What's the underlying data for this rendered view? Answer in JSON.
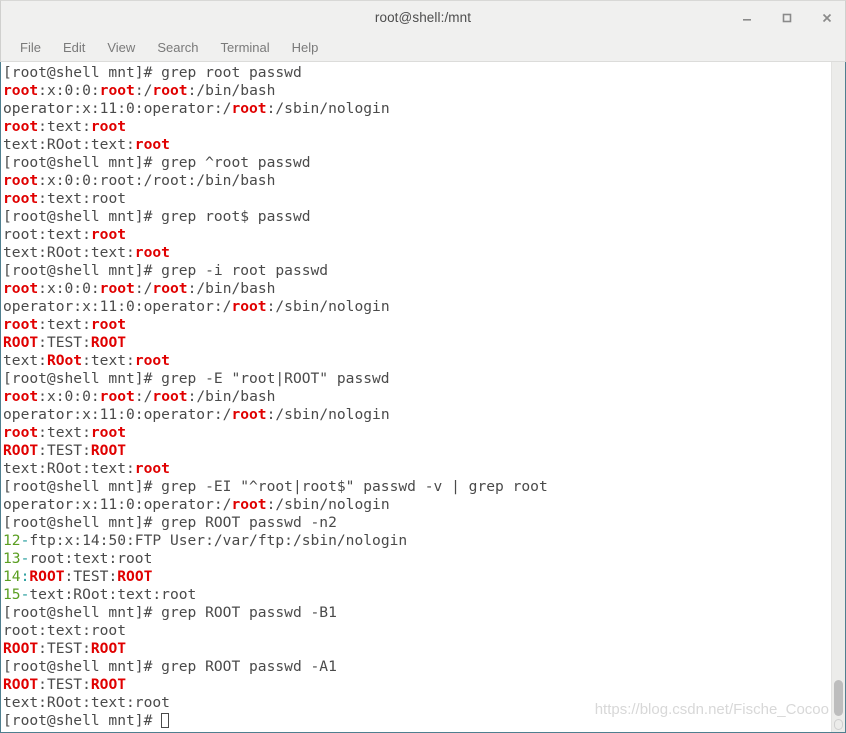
{
  "window": {
    "title": "root@shell:/mnt",
    "buttons": [
      {
        "name": "minimize",
        "glyph": "minimize-icon"
      },
      {
        "name": "maximize",
        "glyph": "maximize-icon"
      },
      {
        "name": "close",
        "glyph": "close-icon"
      }
    ]
  },
  "menubar": {
    "items": [
      "File",
      "Edit",
      "View",
      "Search",
      "Terminal",
      "Help"
    ]
  },
  "colors": {
    "match": "#e00000",
    "line_number": "#5a9e21",
    "separator": "#1f9a9a",
    "text": "#4a4a4a",
    "background": "#ffffff",
    "chrome": "#f0f0ef",
    "border": "#4f7f8f"
  },
  "watermark": "https://blog.csdn.net/Fische_Cocoo",
  "terminal": {
    "prompt": "[root@shell mnt]# ",
    "lines": [
      {
        "type": "prompt",
        "command": "grep root passwd"
      },
      {
        "type": "out",
        "parts": [
          {
            "t": "root",
            "c": "m"
          },
          {
            "t": ":x:0:0:"
          },
          {
            "t": "root",
            "c": "m"
          },
          {
            "t": ":/"
          },
          {
            "t": "root",
            "c": "m"
          },
          {
            "t": ":/bin/bash"
          }
        ]
      },
      {
        "type": "out",
        "parts": [
          {
            "t": "operator:x:11:0:operator:/"
          },
          {
            "t": "root",
            "c": "m"
          },
          {
            "t": ":/sbin/nologin"
          }
        ]
      },
      {
        "type": "out",
        "parts": [
          {
            "t": "root",
            "c": "m"
          },
          {
            "t": ":text:"
          },
          {
            "t": "root",
            "c": "m"
          }
        ]
      },
      {
        "type": "out",
        "parts": [
          {
            "t": "text:ROot:text:"
          },
          {
            "t": "root",
            "c": "m"
          }
        ]
      },
      {
        "type": "prompt",
        "command": "grep ^root passwd"
      },
      {
        "type": "out",
        "parts": [
          {
            "t": "root",
            "c": "m"
          },
          {
            "t": ":x:0:0:root:/root:/bin/bash"
          }
        ]
      },
      {
        "type": "out",
        "parts": [
          {
            "t": "root",
            "c": "m"
          },
          {
            "t": ":text:root"
          }
        ]
      },
      {
        "type": "prompt",
        "command": "grep root$ passwd"
      },
      {
        "type": "out",
        "parts": [
          {
            "t": "root:text:"
          },
          {
            "t": "root",
            "c": "m"
          }
        ]
      },
      {
        "type": "out",
        "parts": [
          {
            "t": "text:ROot:text:"
          },
          {
            "t": "root",
            "c": "m"
          }
        ]
      },
      {
        "type": "prompt",
        "command": "grep -i root passwd"
      },
      {
        "type": "out",
        "parts": [
          {
            "t": "root",
            "c": "m"
          },
          {
            "t": ":x:0:0:"
          },
          {
            "t": "root",
            "c": "m"
          },
          {
            "t": ":/"
          },
          {
            "t": "root",
            "c": "m"
          },
          {
            "t": ":/bin/bash"
          }
        ]
      },
      {
        "type": "out",
        "parts": [
          {
            "t": "operator:x:11:0:operator:/"
          },
          {
            "t": "root",
            "c": "m"
          },
          {
            "t": ":/sbin/nologin"
          }
        ]
      },
      {
        "type": "out",
        "parts": [
          {
            "t": "root",
            "c": "m"
          },
          {
            "t": ":text:"
          },
          {
            "t": "root",
            "c": "m"
          }
        ]
      },
      {
        "type": "out",
        "parts": [
          {
            "t": "ROOT",
            "c": "m"
          },
          {
            "t": ":TEST:"
          },
          {
            "t": "ROOT",
            "c": "m"
          }
        ]
      },
      {
        "type": "out",
        "parts": [
          {
            "t": "text:"
          },
          {
            "t": "ROot",
            "c": "m"
          },
          {
            "t": ":text:"
          },
          {
            "t": "root",
            "c": "m"
          }
        ]
      },
      {
        "type": "prompt",
        "command": "grep -E \"root|ROOT\" passwd"
      },
      {
        "type": "out",
        "parts": [
          {
            "t": "root",
            "c": "m"
          },
          {
            "t": ":x:0:0:"
          },
          {
            "t": "root",
            "c": "m"
          },
          {
            "t": ":/"
          },
          {
            "t": "root",
            "c": "m"
          },
          {
            "t": ":/bin/bash"
          }
        ]
      },
      {
        "type": "out",
        "parts": [
          {
            "t": "operator:x:11:0:operator:/"
          },
          {
            "t": "root",
            "c": "m"
          },
          {
            "t": ":/sbin/nologin"
          }
        ]
      },
      {
        "type": "out",
        "parts": [
          {
            "t": "root",
            "c": "m"
          },
          {
            "t": ":text:"
          },
          {
            "t": "root",
            "c": "m"
          }
        ]
      },
      {
        "type": "out",
        "parts": [
          {
            "t": "ROOT",
            "c": "m"
          },
          {
            "t": ":TEST:"
          },
          {
            "t": "ROOT",
            "c": "m"
          }
        ]
      },
      {
        "type": "out",
        "parts": [
          {
            "t": "text:ROot:text:"
          },
          {
            "t": "root",
            "c": "m"
          }
        ]
      },
      {
        "type": "prompt",
        "command": "grep -EI \"^root|root$\" passwd -v | grep root"
      },
      {
        "type": "out",
        "parts": [
          {
            "t": "operator:x:11:0:operator:/"
          },
          {
            "t": "root",
            "c": "m"
          },
          {
            "t": ":/sbin/nologin"
          }
        ]
      },
      {
        "type": "prompt",
        "command": "grep ROOT passwd -n2"
      },
      {
        "type": "out",
        "parts": [
          {
            "t": "12",
            "c": "ln"
          },
          {
            "t": "-",
            "c": "sep"
          },
          {
            "t": "ftp:x:14:50:FTP User:/var/ftp:/sbin/nologin"
          }
        ]
      },
      {
        "type": "out",
        "parts": [
          {
            "t": "13",
            "c": "ln"
          },
          {
            "t": "-",
            "c": "sep"
          },
          {
            "t": "root:text:root"
          }
        ]
      },
      {
        "type": "out",
        "parts": [
          {
            "t": "14",
            "c": "ln"
          },
          {
            "t": ":",
            "c": "sep"
          },
          {
            "t": "ROOT",
            "c": "m"
          },
          {
            "t": ":TEST:"
          },
          {
            "t": "ROOT",
            "c": "m"
          }
        ]
      },
      {
        "type": "out",
        "parts": [
          {
            "t": "15",
            "c": "ln"
          },
          {
            "t": "-",
            "c": "sep"
          },
          {
            "t": "text:ROot:text:root"
          }
        ]
      },
      {
        "type": "prompt",
        "command": "grep ROOT passwd -B1"
      },
      {
        "type": "out",
        "parts": [
          {
            "t": "root:text:root"
          }
        ]
      },
      {
        "type": "out",
        "parts": [
          {
            "t": "ROOT",
            "c": "m"
          },
          {
            "t": ":TEST:"
          },
          {
            "t": "ROOT",
            "c": "m"
          }
        ]
      },
      {
        "type": "prompt",
        "command": "grep ROOT passwd -A1"
      },
      {
        "type": "out",
        "parts": [
          {
            "t": "ROOT",
            "c": "m"
          },
          {
            "t": ":TEST:"
          },
          {
            "t": "ROOT",
            "c": "m"
          }
        ]
      },
      {
        "type": "out",
        "parts": [
          {
            "t": "text:ROot:text:root"
          }
        ]
      },
      {
        "type": "prompt",
        "command": "",
        "cursor": true
      }
    ]
  }
}
